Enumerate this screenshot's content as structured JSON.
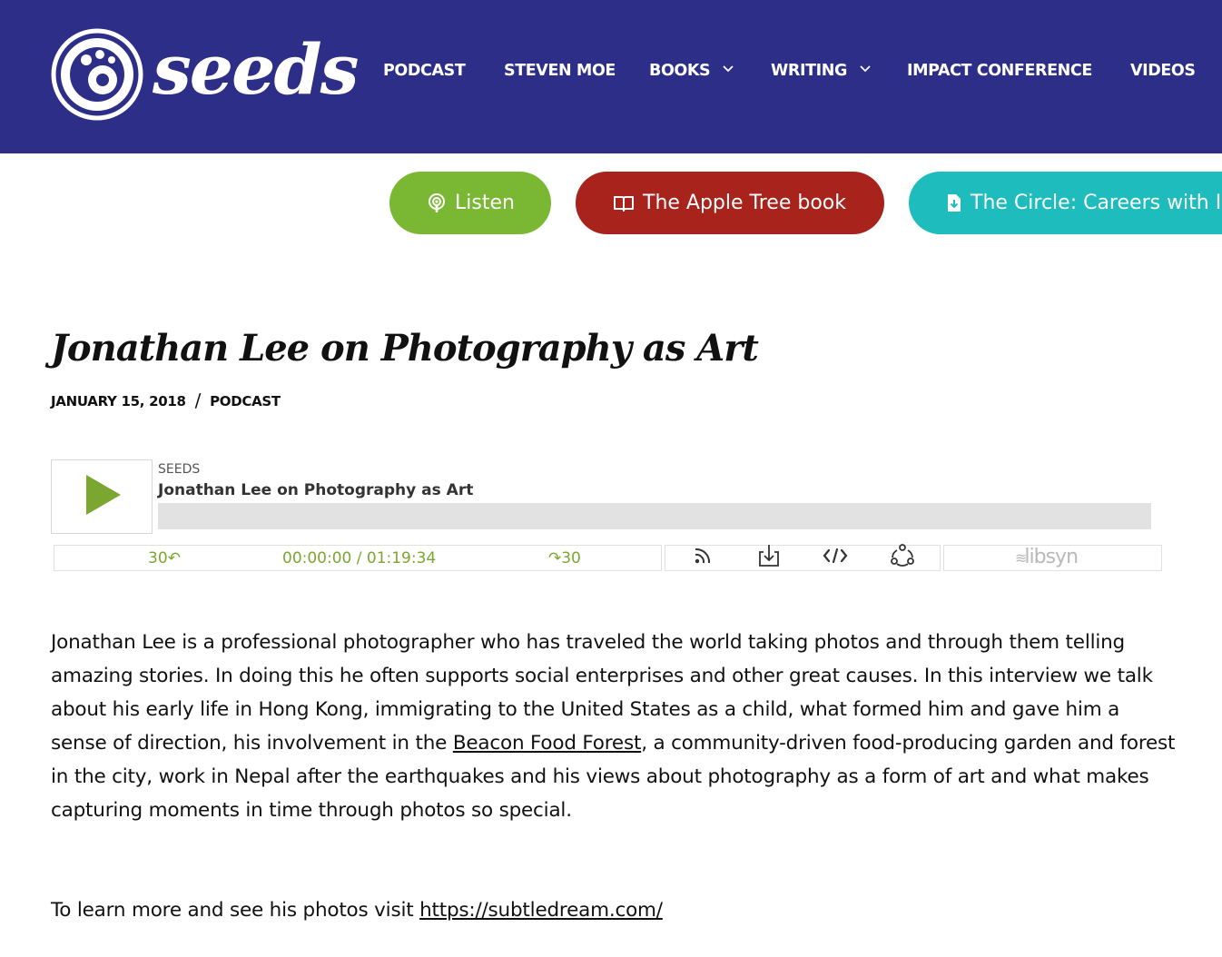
{
  "header": {
    "logo_text": "seeds",
    "nav": [
      {
        "label": "PODCAST"
      },
      {
        "label": "STEVEN MOE"
      },
      {
        "label": "BOOKS"
      },
      {
        "label": "WRITING"
      },
      {
        "label": "IMPACT CONFERENCE"
      },
      {
        "label": "VIDEOS"
      }
    ],
    "background_color": "#2d2e87"
  },
  "buttons": {
    "listen": {
      "label": "Listen",
      "color": "#7ab733"
    },
    "book": {
      "label": "The Apple Tree book",
      "color": "#a8231c"
    },
    "circle": {
      "label": "The Circle: Careers with Impact",
      "color": "#1ebcbc"
    }
  },
  "article": {
    "title": "Jonathan Lee on Photography as Art",
    "date": "JANUARY 15, 2018",
    "separator": "/",
    "category": "PODCAST"
  },
  "player": {
    "show": "SEEDS",
    "episode": "Jonathan Lee on Photography as Art",
    "rewind_label": "30↶",
    "time": "00:00:00 / 01:19:34",
    "forward_label": "↷30",
    "branding": "libsyn",
    "accent_color": "#7ba630"
  },
  "body": {
    "p1_before": "Jonathan Lee is a professional photographer who has traveled the world taking photos and through them telling amazing stories.  In doing this he often supports social enterprises and other great causes.  In this interview we talk about his early life in Hong Kong, immigrating to the United States as a child, what formed him and gave him a sense of direction, his involvement in the ",
    "p1_link": "Beacon Food Forest",
    "p1_after": ", a community-driven food-producing garden and forest in the city, work in Nepal after the earthquakes and his views about photography as a form of art and what makes capturing moments in time through photos so special.",
    "p2_before": "To learn more and see his photos visit ",
    "p2_link": "https://subtledream.com/"
  }
}
